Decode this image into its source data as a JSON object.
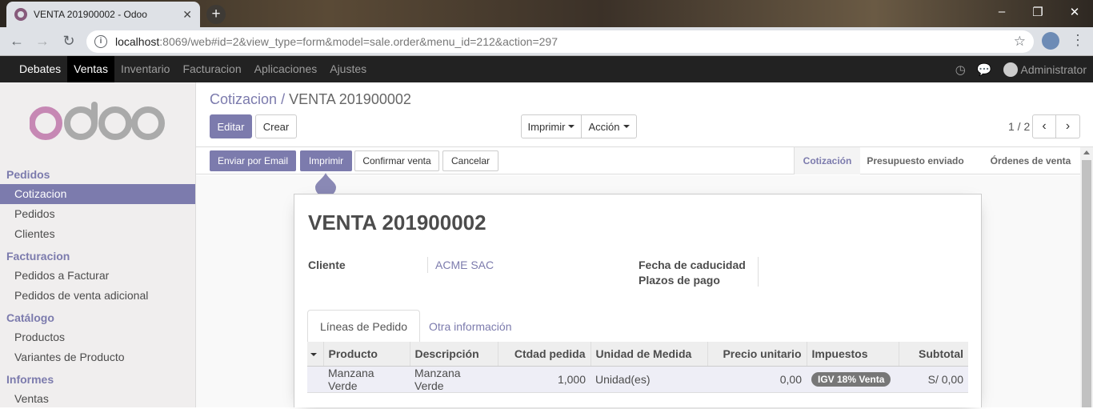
{
  "browser": {
    "tab_title": "VENTA 201900002 - Odoo",
    "url_host": "localhost",
    "url_rest": ":8069/web#id=2&view_type=form&model=sale.order&menu_id=212&action=297"
  },
  "topbar": {
    "menu": [
      "Debates",
      "Ventas",
      "Inventario",
      "Facturacion",
      "Aplicaciones",
      "Ajustes"
    ],
    "user": "Administrator"
  },
  "sidebar": {
    "sections": [
      {
        "title": "Pedidos",
        "items": [
          "Cotizacion",
          "Pedidos",
          "Clientes"
        ]
      },
      {
        "title": "Facturacion",
        "items": [
          "Pedidos a Facturar",
          "Pedidos de venta adicional"
        ]
      },
      {
        "title": "Catálogo",
        "items": [
          "Productos",
          "Variantes de Producto"
        ]
      },
      {
        "title": "Informes",
        "items": [
          "Ventas"
        ]
      }
    ],
    "active_item": "Cotizacion"
  },
  "breadcrumb": {
    "parent": "Cotizacion",
    "separator": "/",
    "current": "VENTA 201900002"
  },
  "controls": {
    "edit": "Editar",
    "create": "Crear",
    "print": "Imprimir",
    "action": "Acción",
    "pager": "1 / 2"
  },
  "statusbar": {
    "send_email": "Enviar por Email",
    "print": "Imprimir",
    "confirm": "Confirmar venta",
    "cancel": "Cancelar",
    "stages": [
      "Cotización",
      "Presupuesto enviado",
      "Órdenes de venta"
    ],
    "current_stage": "Cotización"
  },
  "form": {
    "title": "VENTA 201900002",
    "customer_label": "Cliente",
    "customer_value": "ACME SAC",
    "expiry_label": "Fecha de caducidad",
    "payment_terms_label": "Plazos de pago",
    "tabs": [
      "Líneas de Pedido",
      "Otra información"
    ],
    "columns": [
      "Producto",
      "Descripción",
      "Ctdad pedida",
      "Unidad de Medida",
      "Precio unitario",
      "Impuestos",
      "Subtotal"
    ],
    "rows": [
      {
        "product": "Manzana Verde",
        "description": "Manzana Verde",
        "qty": "1,000",
        "uom": "Unidad(es)",
        "price": "0,00",
        "tax": "IGV 18% Venta",
        "subtotal": "S/ 0,00"
      }
    ]
  },
  "colors": {
    "accent": "#7c7bad",
    "brand": "#875a7b",
    "topbar": "#222222"
  }
}
